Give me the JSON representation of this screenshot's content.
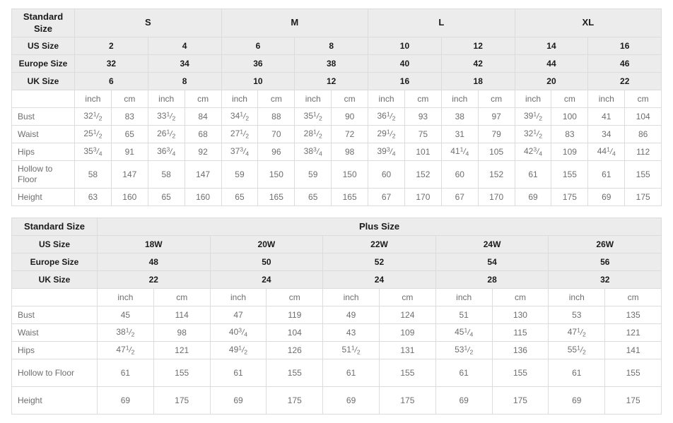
{
  "tables": [
    {
      "id": "standard-size-table",
      "label_col_header": "Standard Size",
      "group_headers": [
        "S",
        "M",
        "L",
        "XL"
      ],
      "rows_header": [
        {
          "label": "US Size",
          "values": [
            "2",
            "4",
            "6",
            "8",
            "10",
            "12",
            "14",
            "16"
          ]
        },
        {
          "label": "Europe Size",
          "values": [
            "32",
            "34",
            "36",
            "38",
            "40",
            "42",
            "44",
            "46"
          ]
        },
        {
          "label": "UK Size",
          "values": [
            "6",
            "8",
            "10",
            "12",
            "16",
            "18",
            "20",
            "22"
          ]
        }
      ],
      "unit_row": [
        "inch",
        "cm",
        "inch",
        "cm",
        "inch",
        "cm",
        "inch",
        "cm",
        "inch",
        "cm",
        "inch",
        "cm",
        "inch",
        "cm",
        "inch",
        "cm"
      ],
      "measure_rows": [
        {
          "label": "Bust",
          "values": [
            "32 1/2",
            "83",
            "33 1/2",
            "84",
            "34 1/2",
            "88",
            "35 1/2",
            "90",
            "36 1/2",
            "93",
            "38",
            "97",
            "39 1/2",
            "100",
            "41",
            "104"
          ]
        },
        {
          "label": "Waist",
          "values": [
            "25 1/2",
            "65",
            "26 1/2",
            "68",
            "27 1/2",
            "70",
            "28 1/2",
            "72",
            "29 1/2",
            "75",
            "31",
            "79",
            "32 1/2",
            "83",
            "34",
            "86"
          ]
        },
        {
          "label": "Hips",
          "values": [
            "35 3/4",
            "91",
            "36 3/4",
            "92",
            "37 3/4",
            "96",
            "38 3/4",
            "98",
            "39 3/4",
            "101",
            "41 1/4",
            "105",
            "42 3/4",
            "109",
            "44 1/4",
            "112"
          ]
        },
        {
          "label": "Hollow to Floor",
          "values": [
            "58",
            "147",
            "58",
            "147",
            "59",
            "150",
            "59",
            "150",
            "60",
            "152",
            "60",
            "152",
            "61",
            "155",
            "61",
            "155"
          ]
        },
        {
          "label": "Height",
          "values": [
            "63",
            "160",
            "65",
            "160",
            "65",
            "165",
            "65",
            "165",
            "67",
            "170",
            "67",
            "170",
            "69",
            "175",
            "69",
            "175"
          ]
        }
      ]
    },
    {
      "id": "plus-size-table",
      "label_col_header": "Standard Size",
      "group_title": "Plus Size",
      "rows_header": [
        {
          "label": "US Size",
          "values": [
            "18W",
            "20W",
            "22W",
            "24W",
            "26W"
          ]
        },
        {
          "label": "Europe Size",
          "values": [
            "48",
            "50",
            "52",
            "54",
            "56"
          ]
        },
        {
          "label": "UK Size",
          "values": [
            "22",
            "24",
            "24",
            "28",
            "32"
          ]
        }
      ],
      "unit_row": [
        "inch",
        "cm",
        "inch",
        "cm",
        "inch",
        "cm",
        "inch",
        "cm",
        "inch",
        "cm"
      ],
      "measure_rows": [
        {
          "label": "Bust",
          "values": [
            "45",
            "114",
            "47",
            "119",
            "49",
            "124",
            "51",
            "130",
            "53",
            "135"
          ]
        },
        {
          "label": "Waist",
          "values": [
            "38 1/2",
            "98",
            "40 3/4",
            "104",
            "43",
            "109",
            "45 1/4",
            "115",
            "47 1/2",
            "121"
          ]
        },
        {
          "label": "Hips",
          "values": [
            "47 1/2",
            "121",
            "49 1/2",
            "126",
            "51 1/2",
            "131",
            "53 1/2",
            "136",
            "55 1/2",
            "141"
          ]
        },
        {
          "label": "Hollow to Floor",
          "values": [
            "61",
            "155",
            "61",
            "155",
            "61",
            "155",
            "61",
            "155",
            "61",
            "155"
          ]
        },
        {
          "label": "Height",
          "values": [
            "69",
            "175",
            "69",
            "175",
            "69",
            "175",
            "69",
            "175",
            "69",
            "175"
          ]
        }
      ]
    }
  ],
  "colors": {
    "header_background": "#ececec",
    "border": "#dcdcdc",
    "body_text": "#6e6e6e",
    "header_text": "#1a1a1a",
    "page_background": "#ffffff"
  }
}
